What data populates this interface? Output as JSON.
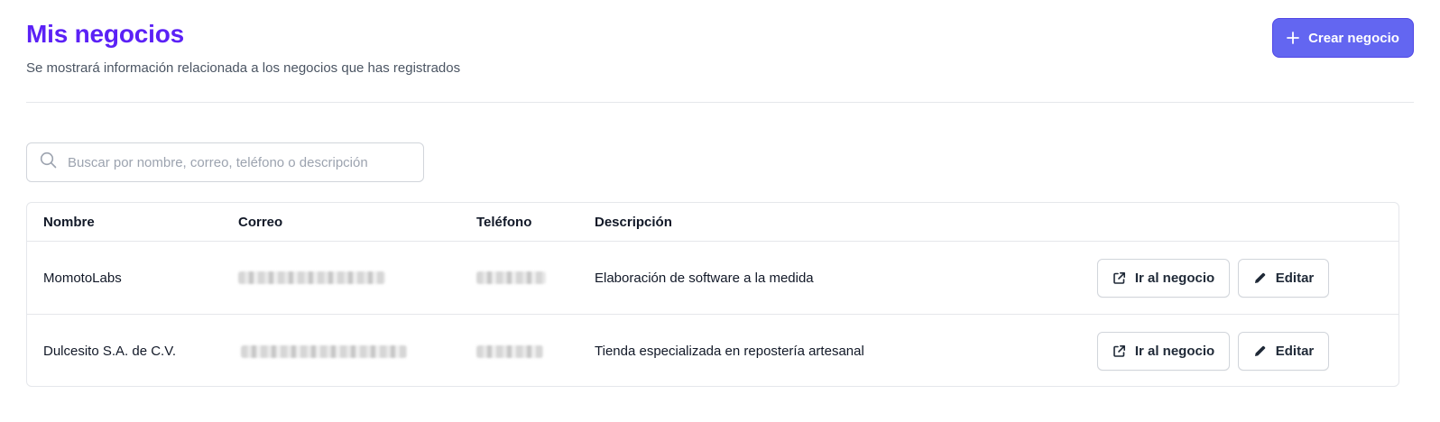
{
  "header": {
    "title": "Mis negocios",
    "subtitle": "Se mostrará información relacionada a los negocios que has registrados",
    "create_button_label": "Crear negocio",
    "create_button_icon": "plus-icon"
  },
  "colors": {
    "title": "#5b21f6",
    "primary_button": "#6366f1",
    "border": "#e5e7eb"
  },
  "search": {
    "placeholder": "Buscar por nombre, correo, teléfono o descripción",
    "value": "",
    "icon": "search-icon"
  },
  "table": {
    "columns": [
      "Nombre",
      "Correo",
      "Teléfono",
      "Descripción"
    ],
    "rows": [
      {
        "name": "MomotoLabs",
        "email_blurred": true,
        "phone_blurred": true,
        "description": "Elaboración de software a la medida",
        "actions": {
          "go_label": "Ir al negocio",
          "go_icon": "external-link-icon",
          "edit_label": "Editar",
          "edit_icon": "pencil-icon"
        }
      },
      {
        "name": "Dulcesito S.A. de C.V.",
        "email_blurred": true,
        "phone_blurred": true,
        "description": "Tienda especializada en repostería artesanal",
        "actions": {
          "go_label": "Ir al negocio",
          "go_icon": "external-link-icon",
          "edit_label": "Editar",
          "edit_icon": "pencil-icon"
        }
      }
    ]
  }
}
